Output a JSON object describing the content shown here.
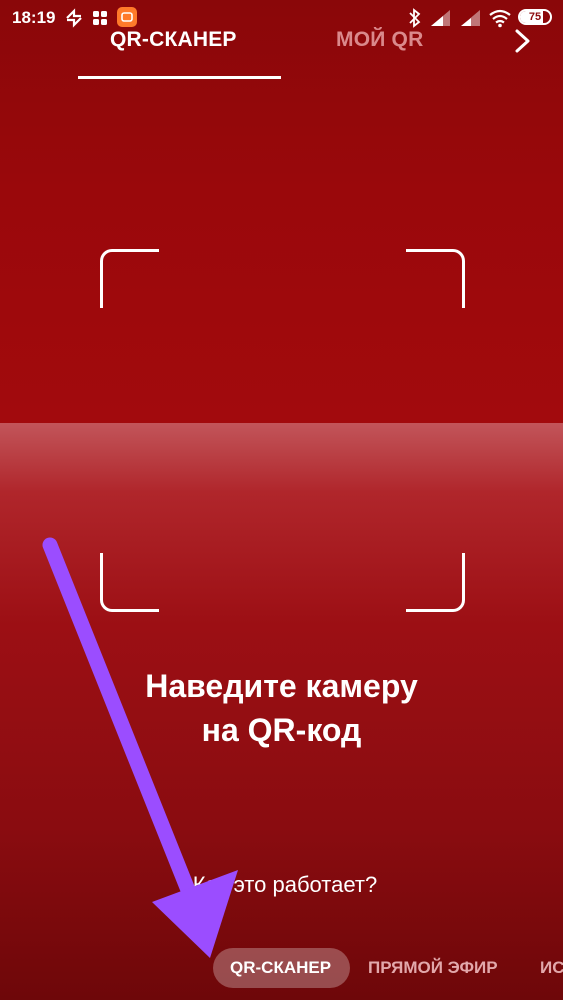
{
  "status_bar": {
    "time": "18:19",
    "battery": "75",
    "battery_level": 0.75
  },
  "tabs": {
    "scanner_label": "QR-СКАНЕР",
    "my_qr_label": "МОЙ QR"
  },
  "instruction": {
    "line1": "Наведите камеру",
    "line2": "на QR-код"
  },
  "help_link": "Как это работает?",
  "modes": {
    "active": "QR-СКАНЕР",
    "live": "ПРЯМОЙ ЭФИР",
    "stories": "ИС"
  },
  "colors": {
    "background": "#8c0a0d",
    "annotation_arrow": "#9b4dff",
    "text": "#ffffff"
  },
  "icons": [
    "network-icon",
    "settings-icon",
    "app-notification-icon",
    "bluetooth-icon",
    "signal-icon",
    "wifi-icon",
    "battery-icon",
    "chevron-right-icon"
  ]
}
